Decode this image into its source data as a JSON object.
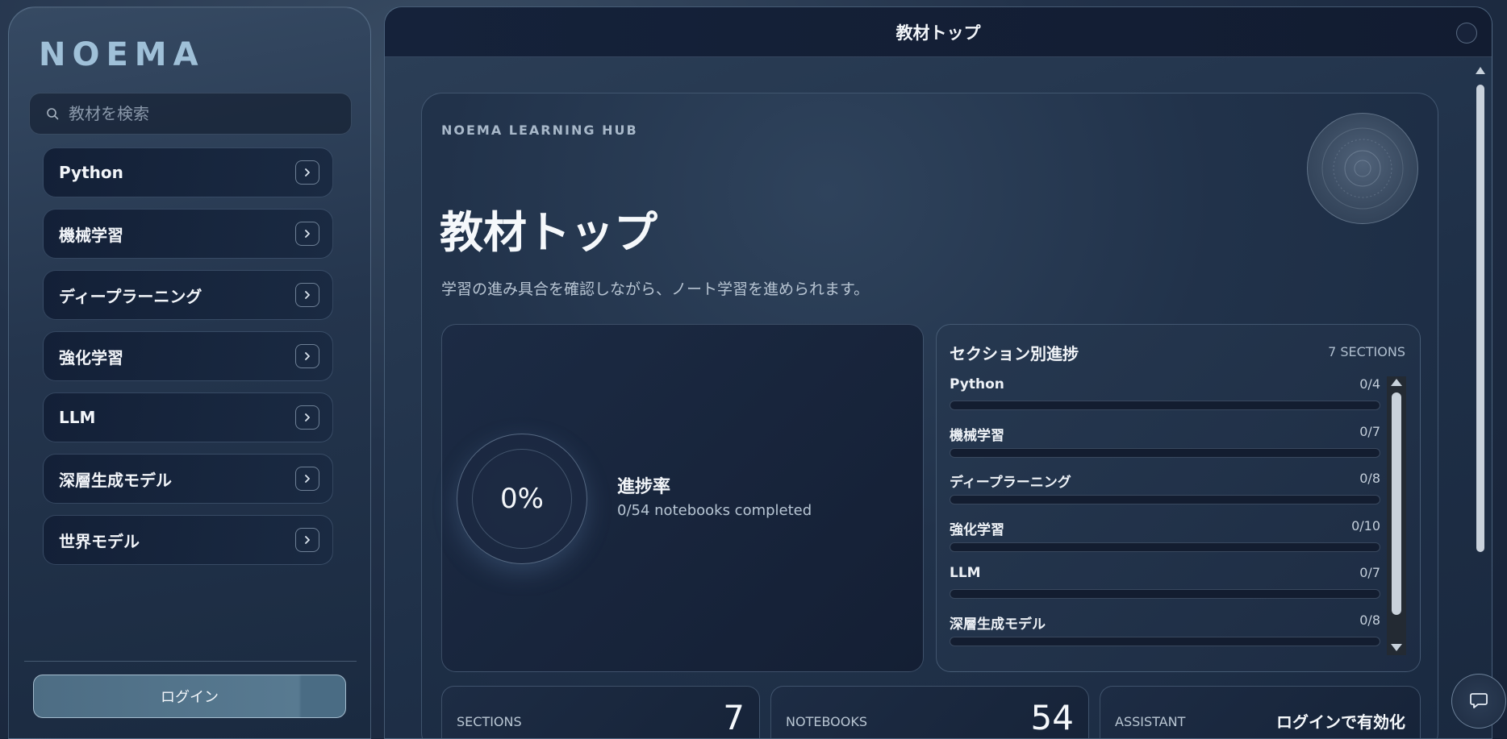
{
  "sidebar": {
    "brand": "NOEMA",
    "search": {
      "placeholder": "教材を検索",
      "value": ""
    },
    "items": [
      {
        "label": "Python"
      },
      {
        "label": "機械学習"
      },
      {
        "label": "ディープラーニング"
      },
      {
        "label": "強化学習"
      },
      {
        "label": "LLM"
      },
      {
        "label": "深層生成モデル"
      },
      {
        "label": "世界モデル"
      }
    ],
    "login_label": "ログイン"
  },
  "window": {
    "title": "教材トップ"
  },
  "hero": {
    "eyebrow": "NOEMA LEARNING HUB",
    "title": "教材トップ",
    "subtitle": "学習の進み具合を確認しながら、ノート学習を進められます。"
  },
  "progress": {
    "percent_text": "0%",
    "label": "進捗率",
    "count_text": "0/54 notebooks completed"
  },
  "sections": {
    "heading": "セクション別進捗",
    "meta": "7 SECTIONS",
    "rows": [
      {
        "name": "Python",
        "count": "0/4",
        "fraction": 0
      },
      {
        "name": "機械学習",
        "count": "0/7",
        "fraction": 0
      },
      {
        "name": "ディープラーニング",
        "count": "0/8",
        "fraction": 0
      },
      {
        "name": "強化学習",
        "count": "0/10",
        "fraction": 0
      },
      {
        "name": "LLM",
        "count": "0/7",
        "fraction": 0
      },
      {
        "name": "深層生成モデル",
        "count": "0/8",
        "fraction": 0
      }
    ]
  },
  "stats": [
    {
      "label": "SECTIONS",
      "value": "7"
    },
    {
      "label": "NOTEBOOKS",
      "value": "54"
    },
    {
      "label": "ASSISTANT",
      "value": "ログインで有効化"
    }
  ],
  "icons": {
    "search": "search-icon",
    "chevron": "chevron-right-icon",
    "chat": "chat-icon"
  },
  "colors": {
    "accent": "#9fc0d8",
    "progress_fill": "#6fa7cf"
  }
}
